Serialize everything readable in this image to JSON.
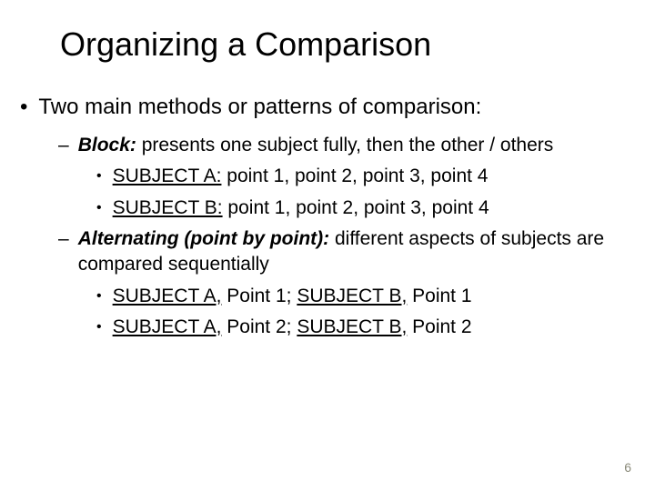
{
  "title": "Organizing a Comparison",
  "main_bullet": "Two main methods or patterns of comparison:",
  "block": {
    "label": "Block:",
    "desc": "  presents one subject fully, then the other / others",
    "subA_label": "SUBJECT A:",
    "subA_rest": " point 1, point 2, point 3, point 4",
    "subB_label": "SUBJECT B:",
    "subB_rest": " point 1, point 2, point 3, point 4"
  },
  "alt": {
    "label": "Alternating (point by point):",
    "desc": "  different aspects of subjects are compared sequentially",
    "line1_a": "SUBJECT A,",
    "line1_mid": " Point 1; ",
    "line1_b": "SUBJECT B,",
    "line1_end": " Point 1",
    "line2_a": "SUBJECT A,",
    "line2_mid": " Point 2; ",
    "line2_b": "SUBJECT B,",
    "line2_end": " Point 2"
  },
  "page_number": "6"
}
